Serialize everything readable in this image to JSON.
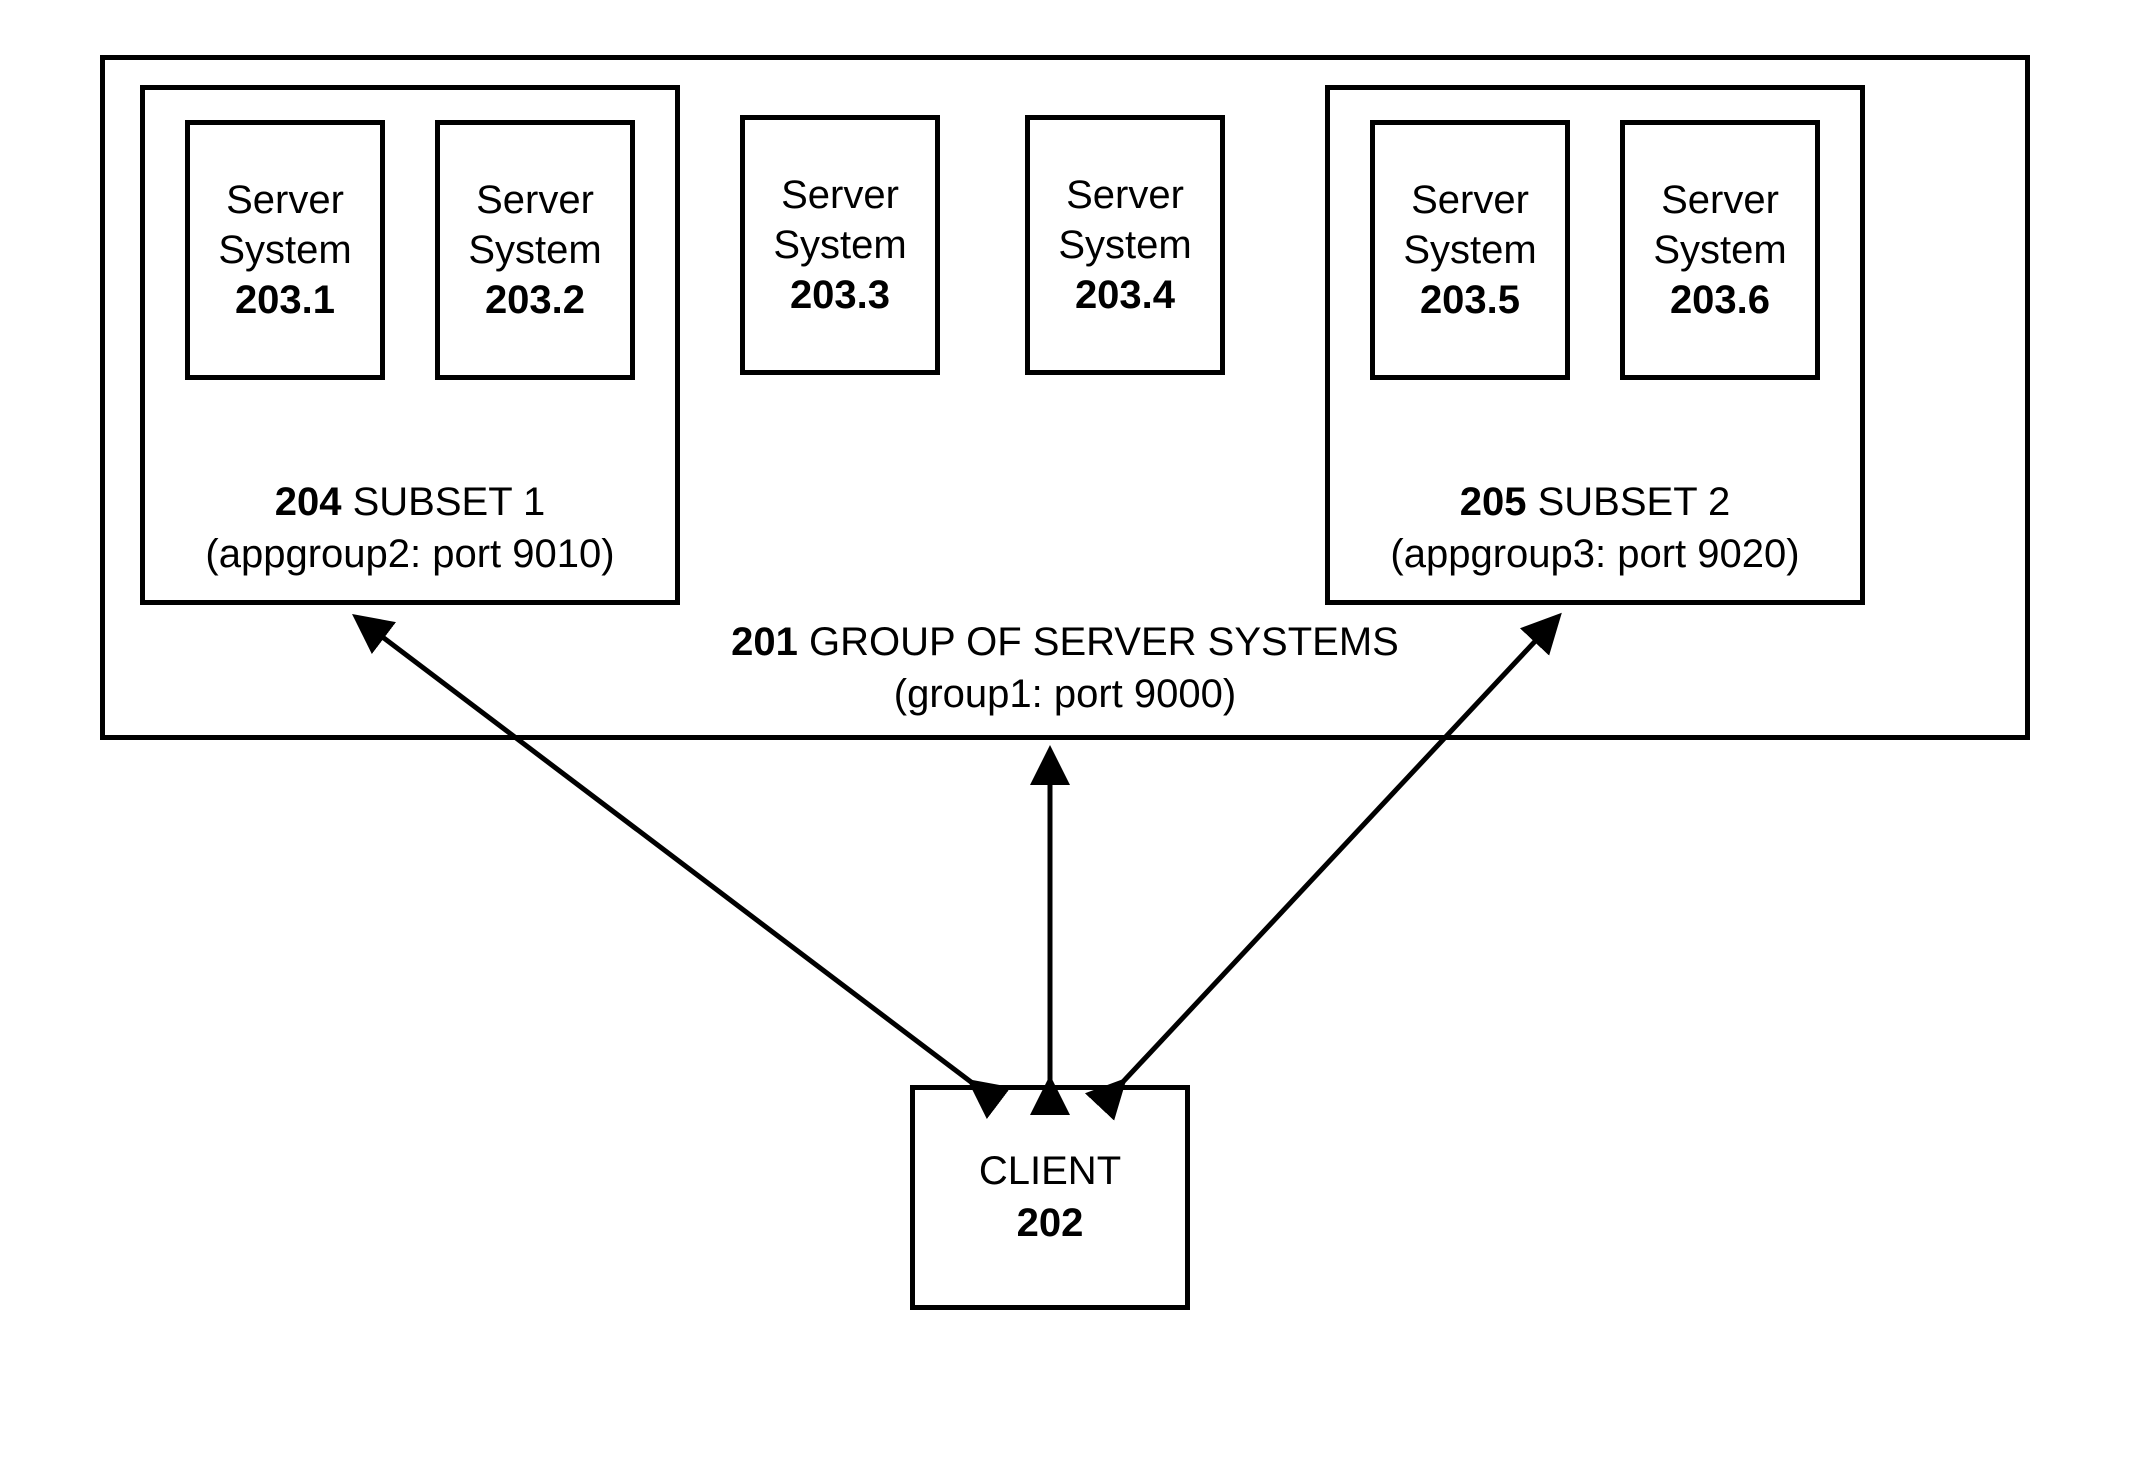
{
  "servers": [
    {
      "label": "Server System",
      "id": "203.1"
    },
    {
      "label": "Server System",
      "id": "203.2"
    },
    {
      "label": "Server System",
      "id": "203.3"
    },
    {
      "label": "Server System",
      "id": "203.4"
    },
    {
      "label": "Server System",
      "id": "203.5"
    },
    {
      "label": "Server System",
      "id": "203.6"
    }
  ],
  "subset1": {
    "ref": "204",
    "title": "SUBSET 1",
    "detail": "(appgroup2: port 9010)"
  },
  "subset2": {
    "ref": "205",
    "title": "SUBSET 2",
    "detail": "(appgroup3: port 9020)"
  },
  "group": {
    "ref": "201",
    "title": "GROUP OF SERVER SYSTEMS",
    "detail": "(group1: port 9000)"
  },
  "client": {
    "label": "CLIENT",
    "ref": "202"
  }
}
